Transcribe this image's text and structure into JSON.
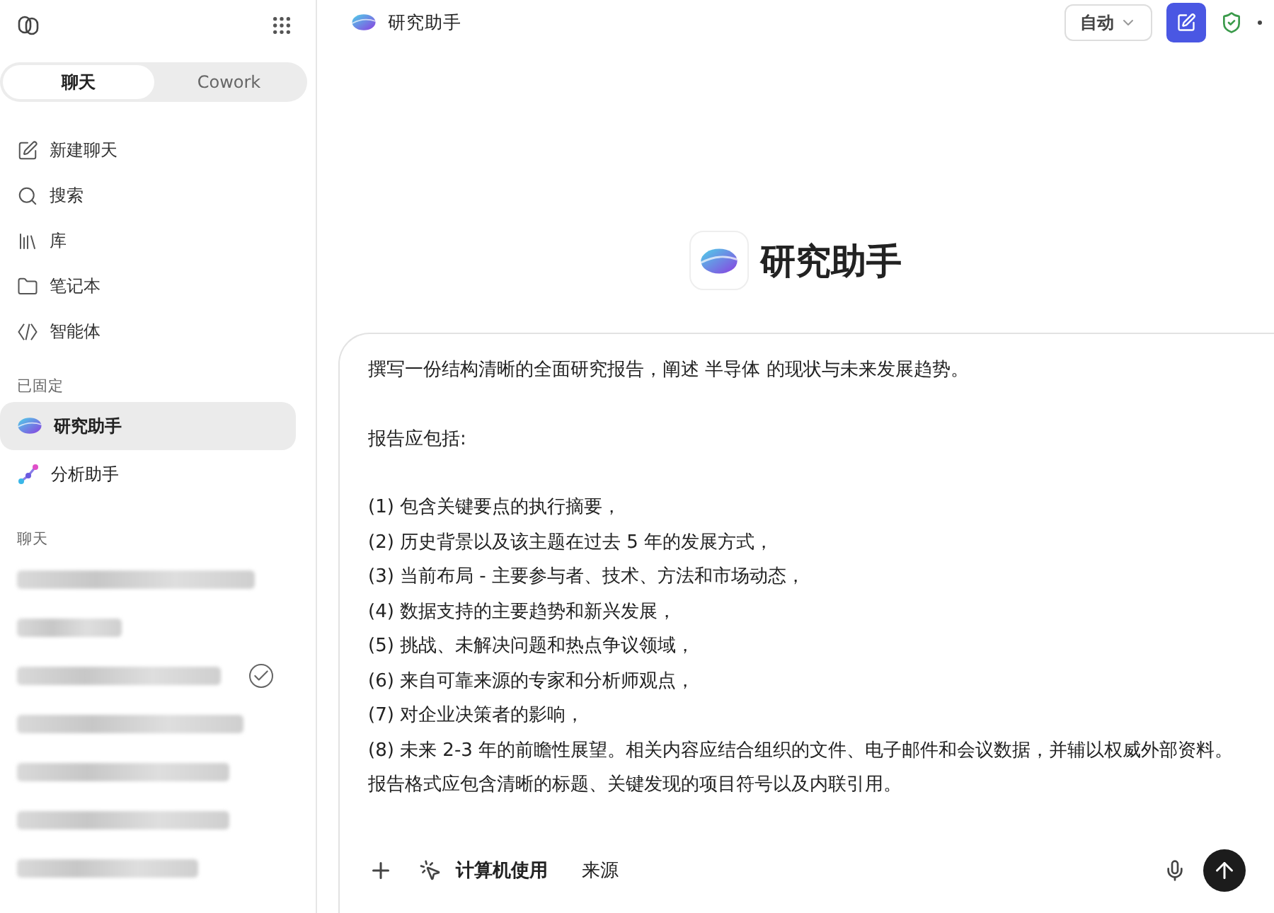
{
  "sidebar": {
    "tabs": [
      {
        "label": "聊天",
        "selected": true
      },
      {
        "label": "Cowork",
        "selected": false
      }
    ],
    "nav": [
      {
        "kind": "new-chat",
        "label": "新建聊天"
      },
      {
        "kind": "search",
        "label": "搜索"
      },
      {
        "kind": "library",
        "label": "库"
      },
      {
        "kind": "notebook",
        "label": "笔记本"
      },
      {
        "kind": "agent",
        "label": "智能体"
      }
    ],
    "pinned_heading": "已固定",
    "pinned": [
      {
        "kind": "research",
        "label": "研究助手",
        "selected": true
      },
      {
        "kind": "analysis",
        "label": "分析助手",
        "selected": false
      }
    ],
    "chats_heading": "聊天",
    "chats": [
      {
        "kind": "blurred",
        "checked": false
      },
      {
        "kind": "blurred",
        "checked": false
      },
      {
        "kind": "blurred",
        "checked": true
      },
      {
        "kind": "blurred",
        "checked": false
      },
      {
        "kind": "blurred",
        "checked": false
      },
      {
        "kind": "blurred",
        "checked": false
      },
      {
        "kind": "blurred",
        "checked": false
      }
    ]
  },
  "header": {
    "title": "研究助手",
    "mode": "自动"
  },
  "agent": {
    "name": "研究助手"
  },
  "composer": {
    "intro": "撰写一份结构清晰的全面研究报告，阐述 半导体 的现状与未来发展趋势。",
    "list_heading": "报告应包括:",
    "items": [
      "(1) 包含关键要点的执行摘要，",
      "(2) 历史背景以及该主题在过去 5 年的发展方式，",
      "(3) 当前布局 - 主要参与者、技术、方法和市场动态，",
      "(4) 数据支持的主要趋势和新兴发展，",
      "(5) 挑战、未解决问题和热点争议领域，",
      "(6) 来自可靠来源的专家和分析师观点，",
      "(7) 对企业决策者的影响，",
      "(8) 未来 2-3 年的前瞻性展望。相关内容应结合组织的文件、电子邮件和会议数据，并辅以权威外部资料。报告格式应包含清晰的标题、关键发现的项目符号以及内联引用。"
    ],
    "tool": "计算机使用",
    "sources": "来源"
  }
}
